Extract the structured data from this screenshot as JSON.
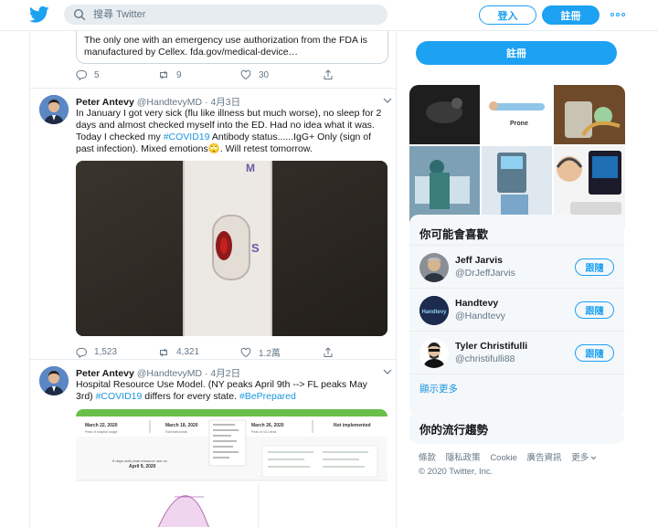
{
  "header": {
    "search_placeholder": "搜尋 Twitter",
    "login_label": "登入",
    "signup_label": "註冊"
  },
  "quoted_tweet": {
    "text": "The only one with an emergency use authorization from the FDA is manufactured by Cellex.  fda.gov/medical-device…"
  },
  "tweets": [
    {
      "actions": {
        "replies": "5",
        "retweets": "9",
        "likes": "30"
      }
    },
    {
      "name": "Peter Antevy",
      "handle": "@HandtevyMD",
      "date": "· 4月3日",
      "text_1": "In January I got very sick (flu like illness but much worse), no sleep for 2 days and almost checked myself into the ED.  Had no idea what it was. Today I checked my ",
      "hashtag": "#COVID19",
      "text_2": " Antibody status......IgG+ Only (sign of past infection).  Mixed emotions🙄.  Will retest tomorrow.",
      "media_marks": {
        "m": "M",
        "s": "S"
      },
      "actions": {
        "replies": "1,523",
        "retweets": "4,321",
        "likes": "1.2萬"
      }
    },
    {
      "name": "Peter Antevy",
      "handle": "@HandtevyMD",
      "date": "· 4月2日",
      "text_1": "Hospital Resource Use Model.  (NY peaks April 9th --> FL peaks May 3rd) ",
      "hashtag": "#COVID19",
      "text_2": " differs for every state. ",
      "hashtag_2": "#BePrepared",
      "media_cards": [
        {
          "date": "March 22, 2020",
          "sub": "Peak of hospital usage"
        },
        {
          "date": "March 18, 2020",
          "sub": "Estimated peak"
        },
        {
          "date": "March 26, 2020",
          "sub": "Peak of ICU beds"
        },
        {
          "date": "Not implemented",
          "sub": ""
        }
      ],
      "media_note": "5 days until peak resource use on",
      "media_note_date": "April 9, 2020"
    }
  ],
  "sidebar": {
    "signup_label": "註冊",
    "who_to_follow": {
      "title": "你可能會喜歡",
      "users": [
        {
          "name": "Jeff Jarvis",
          "handle": "@DrJeffJarvis",
          "follow": "跟隨"
        },
        {
          "name": "Handtevy",
          "handle": "@Handtevy",
          "follow": "跟隨",
          "avatar_text": "Handtevy"
        },
        {
          "name": "Tyler Christifulli",
          "handle": "@christifulli88",
          "follow": "跟隨"
        }
      ],
      "show_more": "顯示更多"
    },
    "trends": {
      "title": "你的流行趨勢"
    },
    "footer": {
      "links": [
        "條款",
        "隱私政策",
        "Cookie",
        "廣告資訊",
        "更多"
      ],
      "copyright": "© 2020 Twitter, Inc."
    }
  },
  "colors": {
    "accent": "#1da1f2",
    "link": "#1b95e0",
    "muted": "#657786",
    "panel_bg": "#f5f8fa"
  }
}
